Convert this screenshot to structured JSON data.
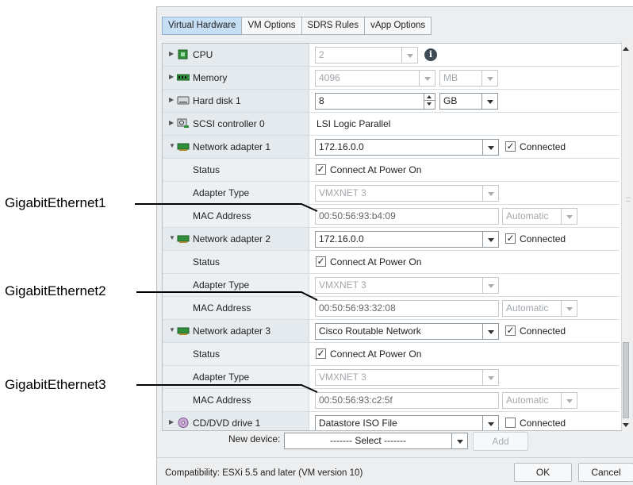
{
  "callouts": [
    "GigabitEthernet1",
    "GigabitEthernet2",
    "GigabitEthernet3"
  ],
  "tabs": [
    "Virtual Hardware",
    "VM Options",
    "SDRS Rules",
    "vApp Options"
  ],
  "rows": {
    "cpu": {
      "label": "CPU",
      "value": "2"
    },
    "memory": {
      "label": "Memory",
      "value": "4096",
      "unit": "MB"
    },
    "hard_disk": {
      "label": "Hard disk 1",
      "value": "8",
      "unit": "GB"
    },
    "scsi": {
      "label": "SCSI controller 0",
      "value": "LSI Logic Parallel"
    },
    "adapters": [
      {
        "label": "Network adapter 1",
        "network": "172.16.0.0",
        "connected_label": "Connected",
        "connected": true,
        "status_label": "Status",
        "status_value": "Connect At Power On",
        "type_label": "Adapter Type",
        "type_value": "VMXNET 3",
        "mac_label": "MAC Address",
        "mac_value": "00:50:56:93:b4:09",
        "mac_mode": "Automatic"
      },
      {
        "label": "Network adapter 2",
        "network": "172.16.0.0",
        "connected_label": "Connected",
        "connected": true,
        "status_label": "Status",
        "status_value": "Connect At Power On",
        "type_label": "Adapter Type",
        "type_value": "VMXNET 3",
        "mac_label": "MAC Address",
        "mac_value": "00:50:56:93:32:08",
        "mac_mode": "Automatic"
      },
      {
        "label": "Network adapter 3",
        "network": "Cisco Routable Network",
        "connected_label": "Connected",
        "connected": true,
        "status_label": "Status",
        "status_value": "Connect At Power On",
        "type_label": "Adapter Type",
        "type_value": "VMXNET 3",
        "mac_label": "MAC Address",
        "mac_value": "00:50:56:93:c2:5f",
        "mac_mode": "Automatic"
      }
    ],
    "cddvd": {
      "label": "CD/DVD drive 1",
      "value": "Datastore ISO File",
      "connected_label": "Connected",
      "connected": false
    }
  },
  "footer": {
    "new_device_label": "New device:",
    "select_value": "------- Select -------",
    "add_label": "Add",
    "compatibility": "Compatibility: ESXi 5.5 and later (VM version 10)",
    "ok_label": "OK",
    "cancel_label": "Cancel"
  },
  "colors": {
    "active_tab": "#c6dff4",
    "label_column": "#e5eaef",
    "dialog_bg": "#eceef0"
  }
}
